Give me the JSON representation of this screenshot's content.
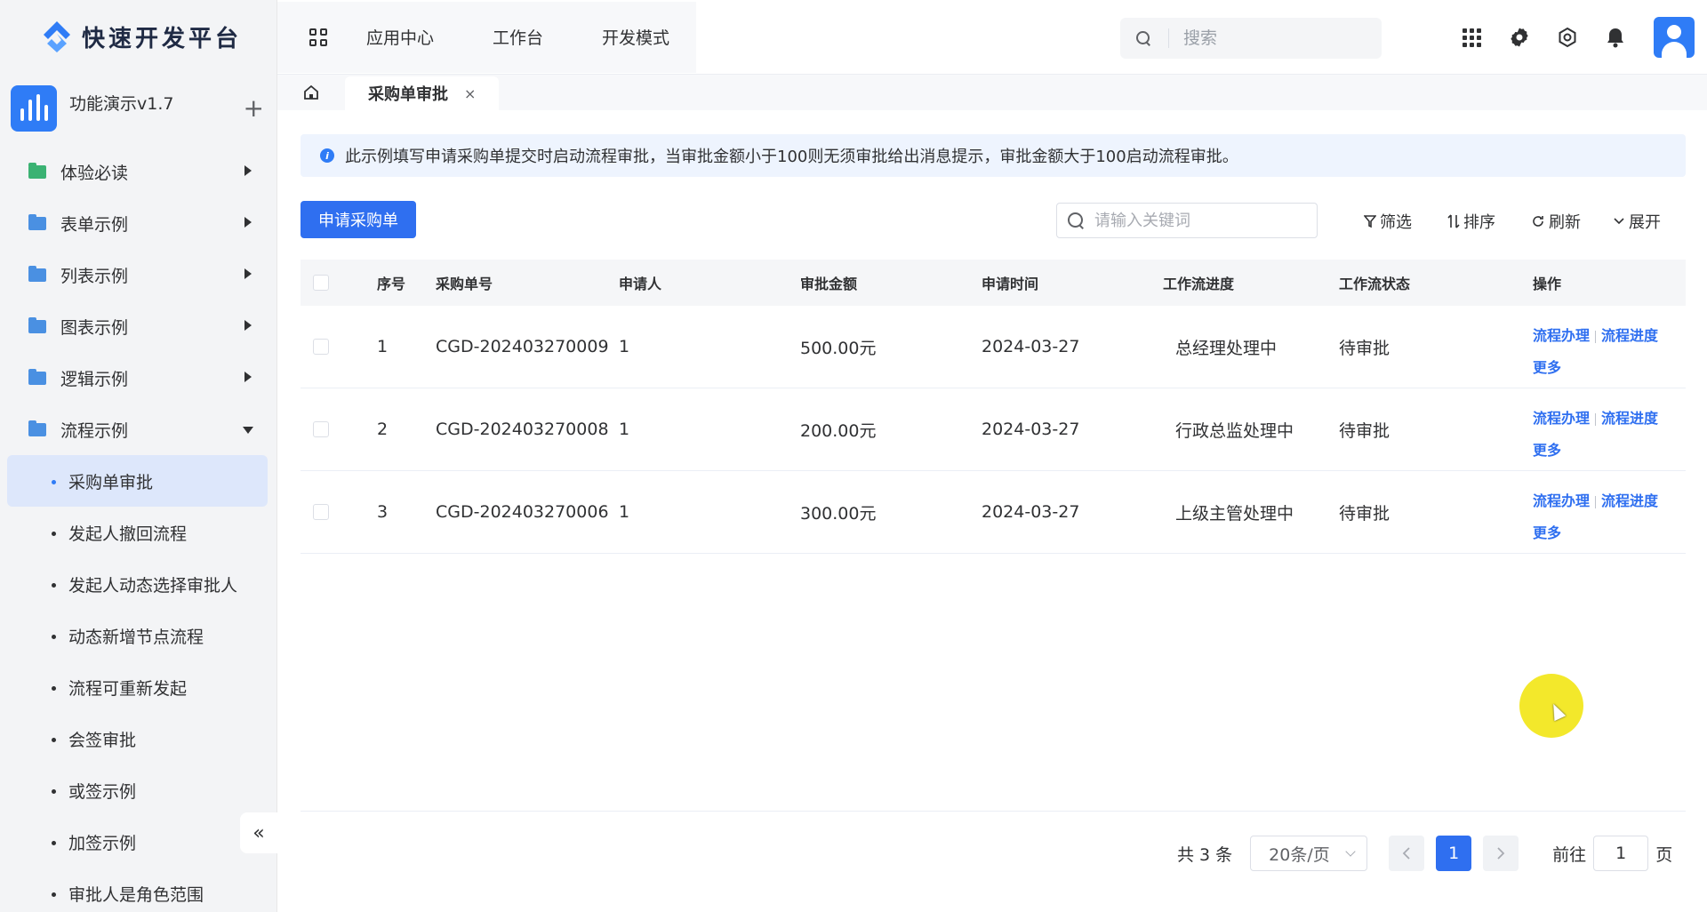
{
  "brand": {
    "name": "快速开发平台",
    "color": "#2f7cf6"
  },
  "app": {
    "name": "功能演示v1.7",
    "add": "+"
  },
  "menu": [
    {
      "label": "体验必读",
      "icon": "doc-icon",
      "color": "#3bb273",
      "expanded": false
    },
    {
      "label": "表单示例",
      "icon": "folder-icon",
      "color": "#4a90e2",
      "expanded": false
    },
    {
      "label": "列表示例",
      "icon": "folder-icon",
      "color": "#4a90e2",
      "expanded": false
    },
    {
      "label": "图表示例",
      "icon": "folder-icon",
      "color": "#4a90e2",
      "expanded": false
    },
    {
      "label": "逻辑示例",
      "icon": "folder-icon",
      "color": "#4a90e2",
      "expanded": false
    },
    {
      "label": "流程示例",
      "icon": "folder-icon",
      "color": "#4a90e2",
      "expanded": true
    }
  ],
  "submenu": [
    {
      "label": "采购单审批",
      "active": true
    },
    {
      "label": "发起人撤回流程"
    },
    {
      "label": "发起人动态选择审批人"
    },
    {
      "label": "动态新增节点流程"
    },
    {
      "label": "流程可重新发起"
    },
    {
      "label": "会签审批"
    },
    {
      "label": "或签示例"
    },
    {
      "label": "加签示例"
    },
    {
      "label": "审批人是角色范围"
    }
  ],
  "collapse": "«",
  "topnav": {
    "items": [
      "应用中心",
      "工作台",
      "开发模式"
    ]
  },
  "search": {
    "placeholder": "搜索"
  },
  "tabs": {
    "active": "采购单审批",
    "close": "×"
  },
  "notice": {
    "icon": "i",
    "text": "此示例填写申请采购单提交时启动流程审批，当审批金额小于100则无须审批给出消息提示，审批金额大于100启动流程审批。"
  },
  "toolbar": {
    "primary": "申请采购单",
    "keyword_placeholder": "请输入关键词",
    "filter": "筛选",
    "sort": "排序",
    "refresh": "刷新",
    "expand": "展开"
  },
  "table": {
    "columns": [
      "序号",
      "采购单号",
      "申请人",
      "审批金额",
      "申请时间",
      "工作流进度",
      "工作流状态",
      "操作"
    ],
    "rows": [
      {
        "index": "1",
        "code": "CGD-202403270009",
        "applicant": "1",
        "amount": "500.00元",
        "date": "2024-03-27",
        "progress": "总经理处理中",
        "status": "待审批"
      },
      {
        "index": "2",
        "code": "CGD-202403270008",
        "applicant": "1",
        "amount": "200.00元",
        "date": "2024-03-27",
        "progress": "行政总监处理中",
        "status": "待审批"
      },
      {
        "index": "3",
        "code": "CGD-202403270006",
        "applicant": "1",
        "amount": "300.00元",
        "date": "2024-03-27",
        "progress": "上级主管处理中",
        "status": "待审批"
      }
    ],
    "actions": {
      "process": "流程办理",
      "progress": "流程进度",
      "more": "更多"
    }
  },
  "pagination": {
    "total": "共 3 条",
    "page_size": "20条/页",
    "current": "1",
    "goto_prefix": "前往",
    "goto_value": "1",
    "goto_suffix": "页"
  }
}
